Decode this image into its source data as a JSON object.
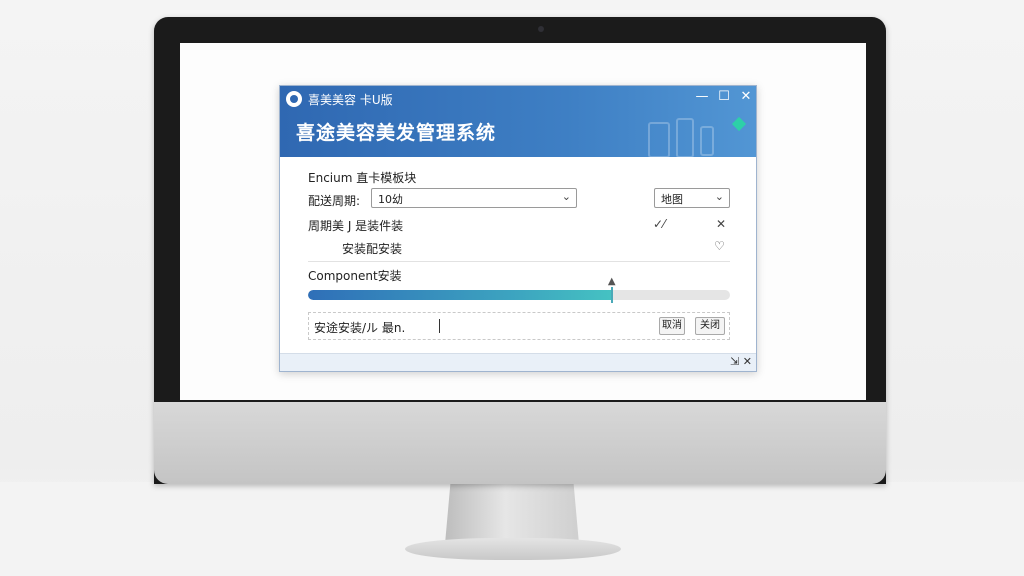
{
  "window": {
    "titlebar_text": "喜美美容 卡U版",
    "app_title": "喜途美容美发管理系统",
    "controls": {
      "minimize": "—",
      "maximize": "☐",
      "close": "✕"
    }
  },
  "form": {
    "field1_label": "Encium 直卡模板块",
    "field2_label": "配送周期:",
    "field2_value": "10幼",
    "right_select_value": "地图",
    "row3_label": "周期美 J 是装件装",
    "row3_mark1": "✓⁄",
    "row3_mark2": "✕",
    "row4_label": "安装配安装",
    "row4_mark": "♡"
  },
  "progress": {
    "label": "Component安装",
    "value_fraction": 0.72,
    "pointer_glyph": "▲"
  },
  "status": {
    "text": "安途安装/ル 最n.",
    "button1": "取消",
    "button2": "关闭"
  },
  "footer": {
    "controls": "⇲ ✕"
  },
  "colors": {
    "header_start": "#2f68b2",
    "header_end": "#5296d4",
    "progress_start": "#2f6fb8",
    "progress_end": "#45c2c2",
    "accent_green": "#2dd0a8"
  }
}
